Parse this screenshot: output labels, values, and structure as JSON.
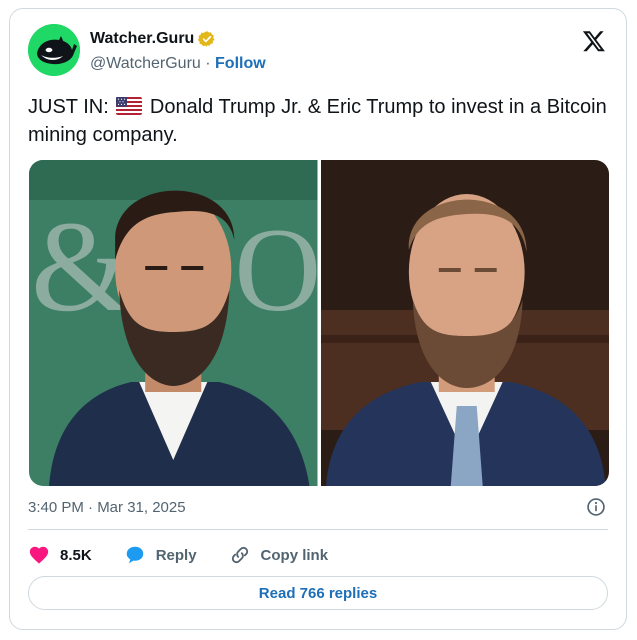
{
  "author": {
    "display_name": "Watcher.Guru",
    "handle": "@WatcherGuru",
    "separator": " · ",
    "follow_label": "Follow",
    "avatar_icon": "whale-logo-icon",
    "verified_icon": "gold-verified-badge-icon"
  },
  "tweet": {
    "text_prefix": "JUST IN:",
    "flag_icon": "us-flag-icon",
    "text_main": "Donald Trump Jr. & Eric Trump to invest in a Bitcoin mining company.",
    "media": [
      {
        "icon": "photo-donald-trump-jr"
      },
      {
        "icon": "photo-eric-trump"
      }
    ],
    "timestamp": "3:40 PM · Mar 31, 2025"
  },
  "actions": {
    "likes": "8.5K",
    "reply_label": "Reply",
    "copy_link_label": "Copy link",
    "read_replies_label": "Read 766 replies"
  },
  "colors": {
    "brand_green": "#1fd865",
    "link_blue": "#1d6fb8",
    "like_pink": "#f91880",
    "reply_blue": "#1d9bf0",
    "border": "#cfd9de",
    "muted_text": "#536471"
  }
}
